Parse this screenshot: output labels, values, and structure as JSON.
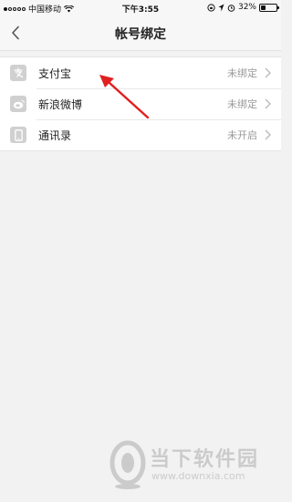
{
  "status_bar": {
    "carrier": "中国移动",
    "time": "下午3:55",
    "battery": "32%",
    "battery_level": 0.32,
    "signal_bars_filled": 1,
    "signal_bars_total": 5
  },
  "nav": {
    "title": "帐号绑定",
    "back_icon": "chevron-left-icon"
  },
  "accounts": [
    {
      "label": "支付宝",
      "status": "未绑定",
      "icon": "alipay-icon"
    },
    {
      "label": "新浪微博",
      "status": "未绑定",
      "icon": "weibo-icon"
    },
    {
      "label": "通讯录",
      "status": "未开启",
      "icon": "contacts-icon"
    }
  ],
  "annotation": {
    "color": "#e02020"
  },
  "watermark": {
    "brand": "当下软件园",
    "url": "www.downxia.com"
  }
}
